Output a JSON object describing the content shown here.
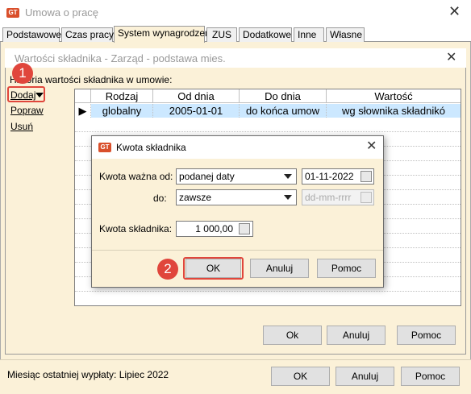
{
  "window": {
    "title": "Umowa o pracę",
    "logo": "GT"
  },
  "tabs": [
    "Podstawowe",
    "Czas pracy",
    "System wynagrodzeń",
    "ZUS",
    "Dodatkowe",
    "Inne",
    "Własne"
  ],
  "inner": {
    "title": "Wartości składnika - Zarząd - podstawa mies.",
    "history_label": "Historia wartości składnika w umowie:",
    "actions": [
      "Dodaj",
      "Popraw",
      "Usuń"
    ],
    "columns": [
      "Rodzaj",
      "Od dnia",
      "Do dnia",
      "Wartość"
    ],
    "row": {
      "rodzaj": "globalny",
      "od": "2005-01-01",
      "do": "do końca umow",
      "wartosc": "wg słownika składnikó"
    },
    "buttons": {
      "ok": "Ok",
      "cancel": "Anuluj",
      "help": "Pomoc"
    }
  },
  "modal": {
    "title": "Kwota składnika",
    "logo": "GT",
    "from_label": "Kwota ważna od:",
    "from_select": "podanej daty",
    "from_date": "01-11-2022",
    "to_label": "do:",
    "to_select": "zawsze",
    "to_date_placeholder": "dd-mm-rrrr",
    "amount_label": "Kwota składnika:",
    "amount_value": "1 000,00",
    "buttons": {
      "ok": "OK",
      "cancel": "Anuluj",
      "help": "Pomoc"
    }
  },
  "footer": {
    "status": "Miesiąc ostatniej wypłaty: Lipiec 2022",
    "buttons": {
      "ok": "OK",
      "cancel": "Anuluj",
      "help": "Pomoc"
    }
  },
  "badges": [
    "1",
    "2"
  ],
  "colors": {
    "accent": "#e0463c",
    "panel": "#fbf1d8",
    "selected_row": "#cce8ff"
  }
}
